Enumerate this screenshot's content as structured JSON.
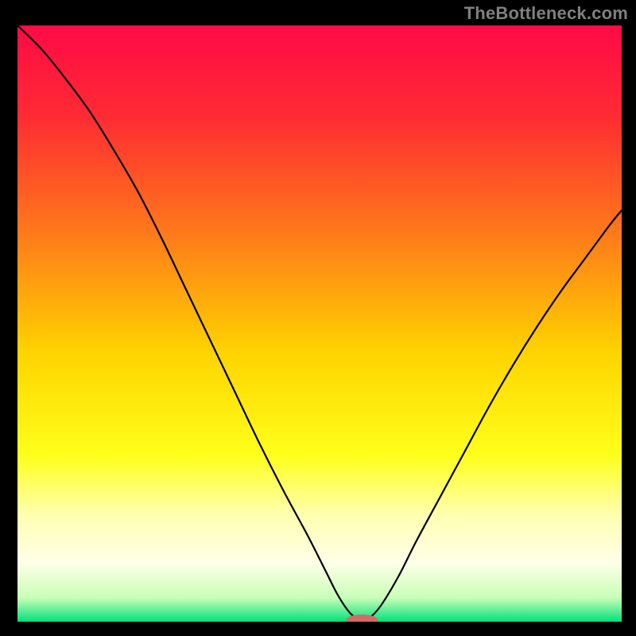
{
  "watermark": "TheBottleneck.com",
  "chart_data": {
    "type": "line",
    "title": "",
    "xlabel": "",
    "ylabel": "",
    "xlim": [
      0,
      100
    ],
    "ylim": [
      0,
      100
    ],
    "gradient_stops": [
      {
        "offset": 0.0,
        "color": "#ff0a46"
      },
      {
        "offset": 0.15,
        "color": "#ff2a33"
      },
      {
        "offset": 0.35,
        "color": "#ff7a1a"
      },
      {
        "offset": 0.55,
        "color": "#ffd400"
      },
      {
        "offset": 0.72,
        "color": "#ffff1a"
      },
      {
        "offset": 0.82,
        "color": "#ffffb0"
      },
      {
        "offset": 0.9,
        "color": "#ffffe8"
      },
      {
        "offset": 0.96,
        "color": "#c8ffb8"
      },
      {
        "offset": 1.0,
        "color": "#00e07a"
      }
    ],
    "series": [
      {
        "name": "bottleneck-curve",
        "x": [
          0,
          4,
          8,
          12,
          16,
          20,
          24,
          28,
          32,
          36,
          40,
          44,
          48,
          51,
          53,
          55,
          56.5,
          58,
          60,
          63,
          66,
          70,
          74,
          78,
          82,
          86,
          90,
          94,
          98,
          100
        ],
        "values": [
          100,
          96,
          91,
          85.5,
          79,
          72,
          64,
          55.5,
          47,
          38.5,
          30,
          22,
          14.5,
          8.5,
          4.5,
          1.5,
          0.5,
          0.5,
          2.5,
          7.5,
          13.5,
          21,
          28.5,
          36,
          43,
          49.5,
          55.5,
          61,
          66.5,
          69
        ]
      }
    ],
    "marker": {
      "name": "bottleneck-point",
      "x": 57,
      "y": 0.3,
      "rx": 2.6,
      "ry": 0.9,
      "fill": "#d46a6a"
    },
    "curve_stroke": "#000000",
    "curve_stroke_width": 2.2
  }
}
